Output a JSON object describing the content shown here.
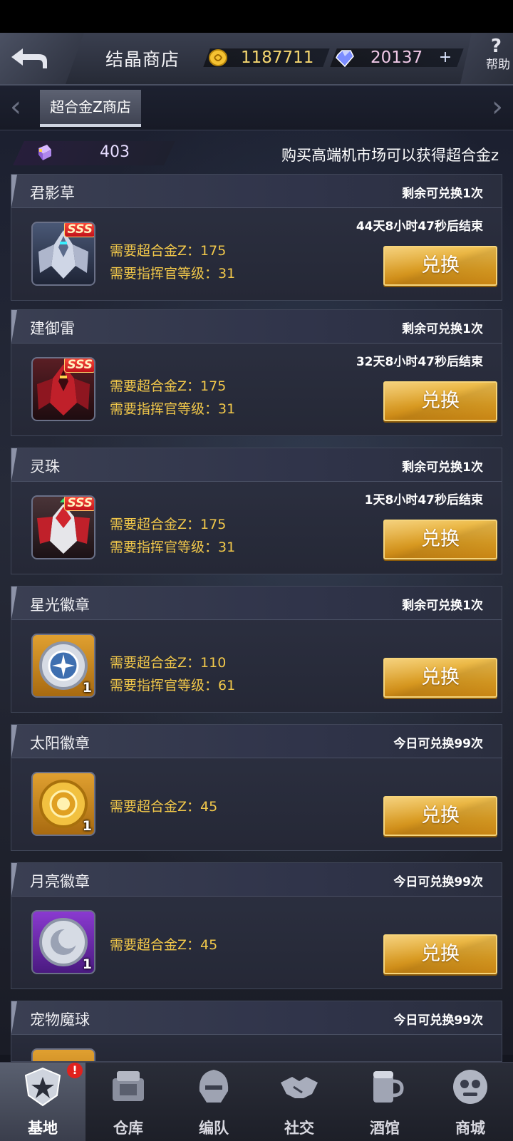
{
  "header": {
    "title": "结晶商店",
    "gold": "1187711",
    "crystal": "20137",
    "plus": "+",
    "help_icon": "?",
    "help_label": "帮助"
  },
  "tabs": {
    "left_arrow": "‹",
    "active": "超合金Z商店",
    "right_arrow": "›"
  },
  "info": {
    "alloy_count": "403",
    "hint": "购买高端机市场可以获得超合金z"
  },
  "colors": {
    "accent_gold": "#f2c84a",
    "button_gold": "#e0a832",
    "alert": "#e0221e"
  },
  "items": [
    {
      "name": "君影草",
      "limit": "剩余可兑换1次",
      "timer": "44天8小时47秒后结束",
      "req1": "需要超合金Z：175",
      "req2": "需要指挥官等级：31",
      "badge": "SSS",
      "qty": "",
      "icon": "white-mecha-icon",
      "button": "兑换"
    },
    {
      "name": "建御雷",
      "limit": "剩余可兑换1次",
      "timer": "32天8小时47秒后结束",
      "req1": "需要超合金Z：175",
      "req2": "需要指挥官等级：31",
      "badge": "SSS",
      "qty": "",
      "icon": "red-mecha-icon",
      "button": "兑换"
    },
    {
      "name": "灵珠",
      "limit": "剩余可兑换1次",
      "timer": "1天8小时47秒后结束",
      "req1": "需要超合金Z：175",
      "req2": "需要指挥官等级：31",
      "badge": "SSS",
      "qty": "",
      "icon": "red-white-mecha-icon",
      "button": "兑换"
    },
    {
      "name": "星光徽章",
      "limit": "剩余可兑换1次",
      "timer": "",
      "req1": "需要超合金Z：110",
      "req2": "需要指挥官等级：61",
      "badge": "",
      "qty": "1",
      "icon": "star-badge-icon",
      "button": "兑换"
    },
    {
      "name": "太阳徽章",
      "limit": "今日可兑换99次",
      "timer": "",
      "req1": "需要超合金Z：45",
      "req2": "",
      "badge": "",
      "qty": "1",
      "icon": "sun-badge-icon",
      "button": "兑换"
    },
    {
      "name": "月亮徽章",
      "limit": "今日可兑换99次",
      "timer": "",
      "req1": "需要超合金Z：45",
      "req2": "",
      "badge": "",
      "qty": "1",
      "icon": "moon-badge-icon",
      "button": "兑换"
    },
    {
      "name": "宠物魔球",
      "limit": "今日可兑换99次",
      "timer": "",
      "req1": "",
      "req2": "",
      "badge": "",
      "qty": "",
      "icon": "pet-ball-icon",
      "button": ""
    }
  ],
  "nav": [
    {
      "label": "基地",
      "icon": "base-emblem-icon",
      "active": true,
      "alert": "!"
    },
    {
      "label": "仓库",
      "icon": "warehouse-icon"
    },
    {
      "label": "编队",
      "icon": "formation-helmet-icon"
    },
    {
      "label": "社交",
      "icon": "handshake-icon"
    },
    {
      "label": "酒馆",
      "icon": "tavern-icon"
    },
    {
      "label": "商城",
      "icon": "mall-robot-icon"
    }
  ]
}
